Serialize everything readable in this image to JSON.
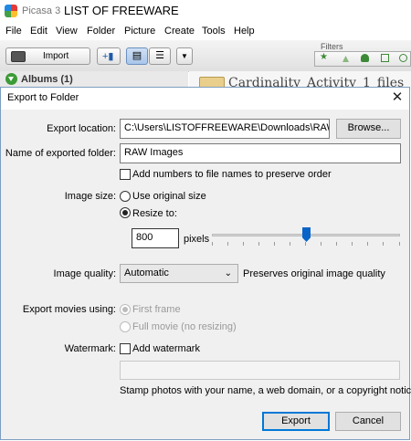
{
  "app": {
    "name": "Picasa 3",
    "window_title": "LIST OF FREEWARE"
  },
  "menu": [
    "File",
    "Edit",
    "View",
    "Folder",
    "Picture",
    "Create",
    "Tools",
    "Help"
  ],
  "toolbar": {
    "import_label": "Import",
    "filters_label": "Filters"
  },
  "sidebar": {
    "albums_label": "Albums (1)"
  },
  "content": {
    "folder_title": "Cardinality_Activity_1_files"
  },
  "dialog": {
    "title": "Export to Folder",
    "export_location_label": "Export location:",
    "export_location_value": "C:\\Users\\LISTOFFREEWARE\\Downloads\\RAW Images",
    "browse_label": "Browse...",
    "folder_name_label": "Name of exported folder:",
    "folder_name_value": "RAW Images",
    "add_numbers_label": "Add numbers to file names to preserve order",
    "add_numbers_checked": false,
    "image_size_label": "Image size:",
    "use_original_label": "Use original size",
    "resize_label": "Resize to:",
    "image_size_selected": "resize",
    "resize_value": "800",
    "pixels_label": "pixels",
    "image_quality_label": "Image quality:",
    "image_quality_value": "Automatic",
    "image_quality_note": "Preserves original image quality",
    "export_movies_label": "Export movies using:",
    "first_frame_label": "First frame",
    "full_movie_label": "Full movie (no resizing)",
    "export_movies_selected": "first_frame",
    "watermark_label": "Watermark:",
    "add_watermark_label": "Add watermark",
    "add_watermark_checked": false,
    "watermark_text": "",
    "stamp_note": "Stamp photos with your name, a web domain, or a copyright notice.",
    "export_button": "Export",
    "cancel_button": "Cancel"
  },
  "colors": {
    "accent": "#0078d7",
    "slider_thumb": "#0a64c8",
    "dialog_bg": "#f0f0f0"
  }
}
